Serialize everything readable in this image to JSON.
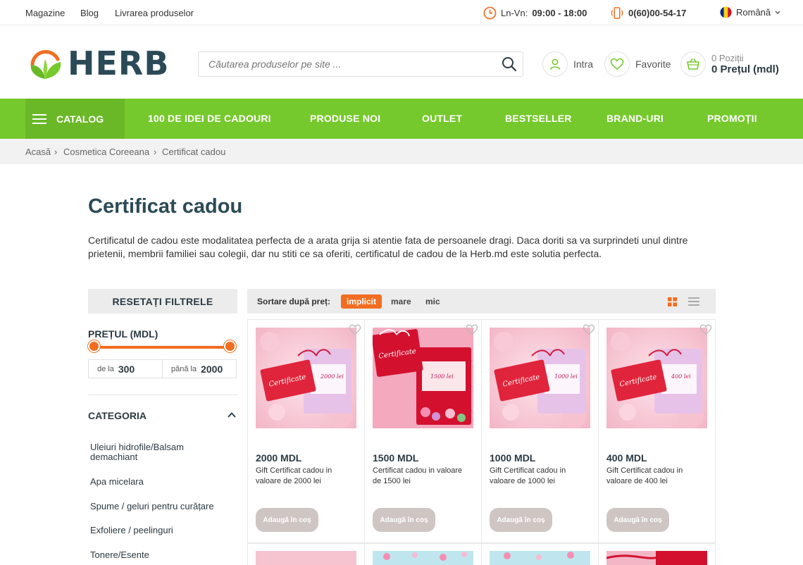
{
  "topbar": {
    "links": [
      "Magazine",
      "Blog",
      "Livrarea produselor"
    ],
    "hours_label": "Ln-Vn:",
    "hours": "09:00 - 18:00",
    "phone": "0(60)00-54-17",
    "language": "Română"
  },
  "header": {
    "logo_text": "HERB",
    "search_placeholder": "Căutarea produselor pe site ...",
    "login_label": "Intra",
    "favorites_label": "Favorite",
    "cart_items": "0 Poziții",
    "cart_price": "0 Prețul (mdl)"
  },
  "nav": {
    "catalog": "CATALOG",
    "items": [
      "100 DE IDEI DE CADOURI",
      "PRODUSE NOI",
      "OUTLET",
      "BESTSELLER",
      "BRAND-URI",
      "PROMOȚII"
    ]
  },
  "breadcrumb": [
    "Acasă",
    "Cosmetica Coreeana",
    "Certificat cadou"
  ],
  "page": {
    "title": "Certificat cadou",
    "description": "Certificatul de cadou este modalitatea perfecta de a arata grija si atentie fata de persoanele dragi. Daca doriti sa va surprindeti unul dintre prietenii, membrii familiei sau colegii, dar nu stiti ce sa oferiti, certificatul de cadou de la Herb.md este solutia perfecta."
  },
  "filters": {
    "reset": "RESETAȚI FILTRELE",
    "price_heading": "PREȚUL (MDL)",
    "from_label": "de la",
    "from_value": "300",
    "to_label": "până la",
    "to_value": "2000",
    "category_heading": "CATEGORIA",
    "categories": [
      "Uleiuri hidrofile/Balsam demachiant",
      "Apa micelara",
      "Spume / geluri pentru curățare",
      "Exfoliere / peelinguri",
      "Tonere/Esente"
    ]
  },
  "sort": {
    "label": "Sortare după preț:",
    "options": [
      "implicit",
      "mare",
      "mic"
    ],
    "active": "implicit"
  },
  "products": [
    {
      "price": "2000 MDL",
      "name": "Gift Certificat cadou in valoare de 2000 lei",
      "button": "Adaugă în coș",
      "card_amount": "2000 lei"
    },
    {
      "price": "1500 MDL",
      "name": "Certificat cadou in valoare de 1500 lei",
      "button": "Adaugă în coș",
      "card_amount": "1500 lei"
    },
    {
      "price": "1000 MDL",
      "name": "Gift Certificat cadou in valoare de 1000 lei",
      "button": "Adaugă în coș",
      "card_amount": "1000 lei"
    },
    {
      "price": "400 MDL",
      "name": "Gift Certificat cadou in valoare de 400 lei",
      "button": "Adaugă în coș",
      "card_amount": "400 lei"
    }
  ],
  "colors": {
    "accent_green": "#76c92c",
    "accent_orange": "#f26d21",
    "brand_dark": "#2b4a57"
  }
}
